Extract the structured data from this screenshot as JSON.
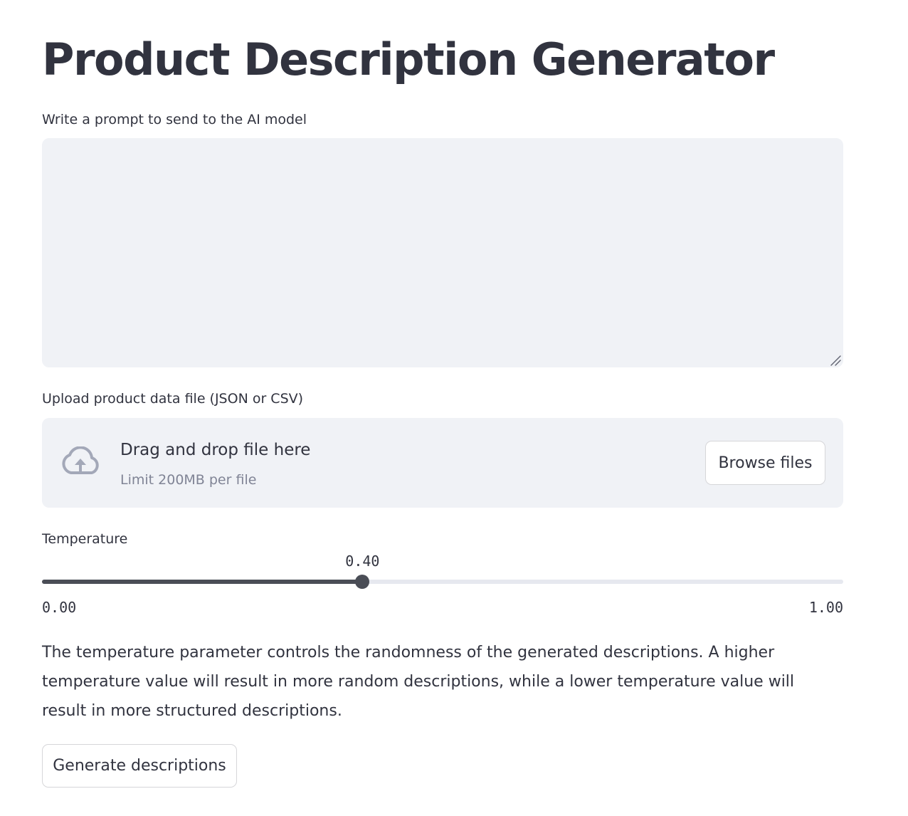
{
  "page": {
    "title": "Product Description Generator"
  },
  "prompt": {
    "label": "Write a prompt to send to the AI model",
    "value": "",
    "placeholder": ""
  },
  "upload": {
    "label": "Upload product data file (JSON or CSV)",
    "dropzone_title": "Drag and drop file here",
    "limit_text": "Limit 200MB per file",
    "browse_label": "Browse files",
    "icon": "cloud-upload-icon"
  },
  "temperature": {
    "label": "Temperature",
    "value": 0.4,
    "value_text": "0.40",
    "min_text": "0.00",
    "max_text": "1.00",
    "min": 0,
    "max": 1
  },
  "description": "The temperature parameter controls the randomness of the generated descriptions. A higher temperature value will result in more random descriptions, while a lower temperature value will result in more structured descriptions.",
  "actions": {
    "generate_label": "Generate descriptions"
  },
  "colors": {
    "text": "#31333f",
    "muted": "#808495",
    "input_background": "#f0f2f6",
    "slider_active": "#4a4d56",
    "slider_track": "#e6e8ef"
  }
}
